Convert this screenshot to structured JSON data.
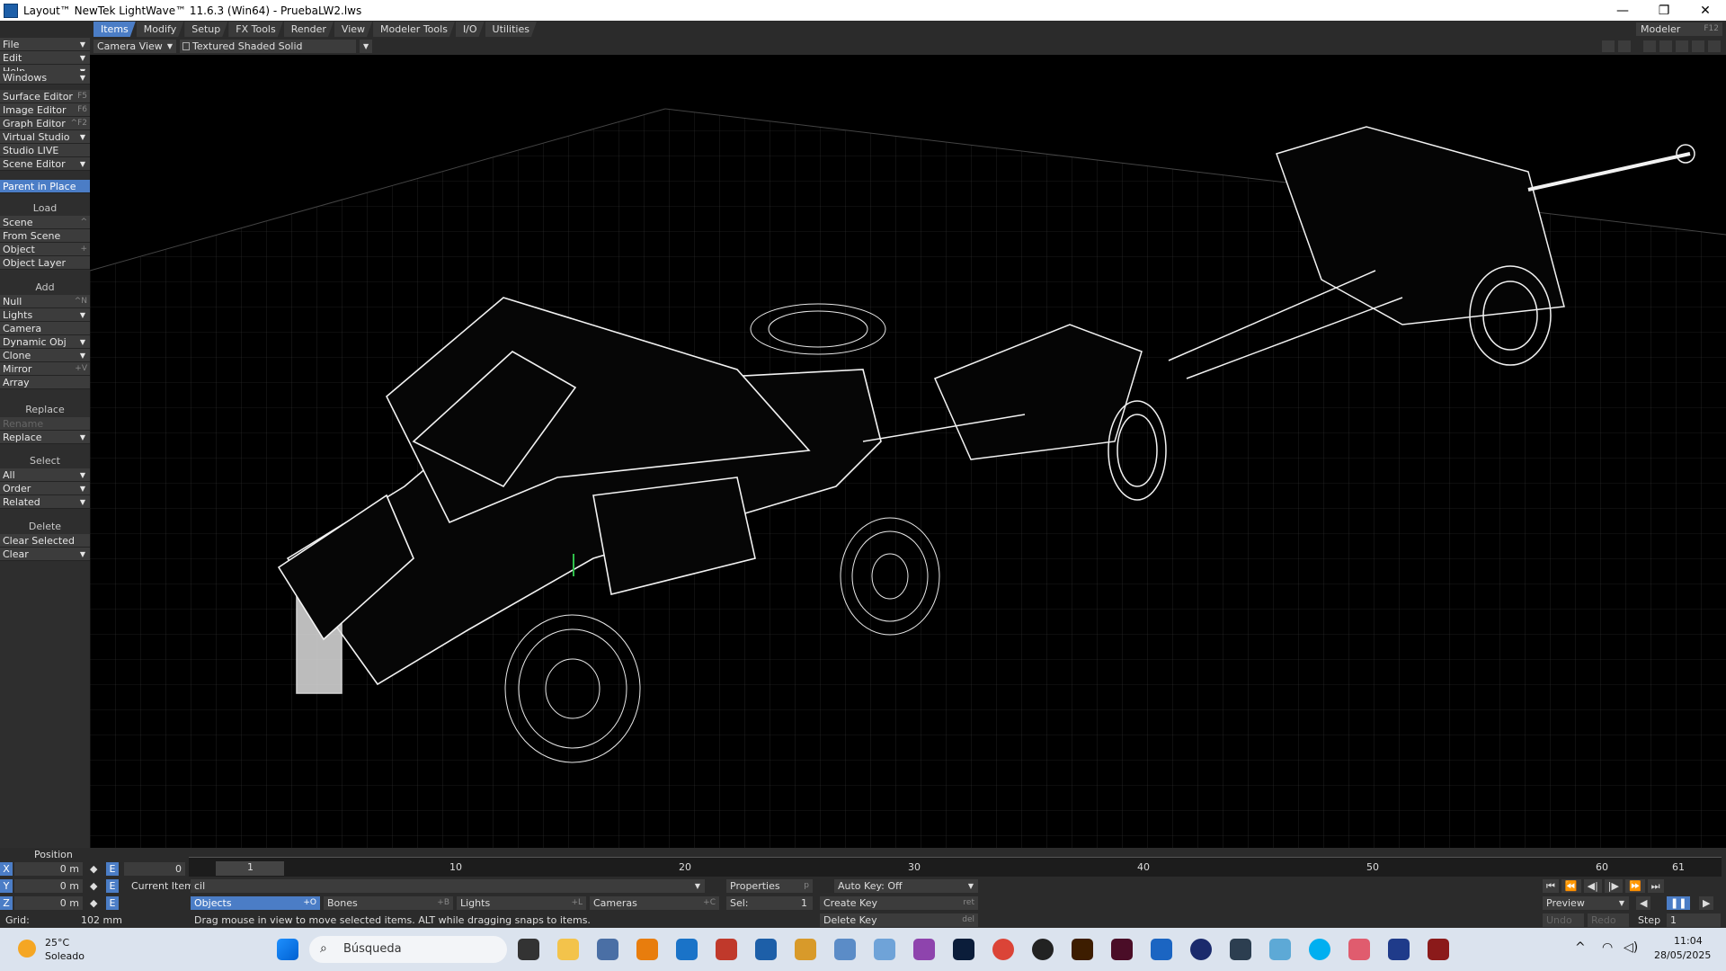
{
  "window": {
    "title": "Layout™ NewTek LightWave™ 11.6.3 (Win64) - PruebaLW2.lws",
    "minimize": "—",
    "maximize": "❐",
    "close": "✕"
  },
  "menu_tabs": [
    "Items",
    "Modify",
    "Setup",
    "FX Tools",
    "Render",
    "View",
    "Modeler Tools",
    "I/O",
    "Utilities"
  ],
  "modeler_button": {
    "label": "Modeler",
    "shortcut": "F12"
  },
  "left_panel": {
    "top": [
      {
        "label": "File",
        "dd": true
      },
      {
        "label": "Edit",
        "dd": true
      },
      {
        "label": "Help",
        "dd": true
      }
    ],
    "windows": {
      "label": "Windows",
      "dd": true
    },
    "editors": [
      {
        "label": "Surface Editor",
        "sc": "F5"
      },
      {
        "label": "Image Editor",
        "sc": "F6"
      },
      {
        "label": "Graph Editor",
        "sc": "^F2"
      },
      {
        "label": "Virtual Studio",
        "dd": true
      },
      {
        "label": "Studio LIVE"
      },
      {
        "label": "Scene Editor",
        "dd": true
      }
    ],
    "parent_in_place": "Parent in Place",
    "load_label": "Load",
    "load": [
      {
        "label": "Scene",
        "sc": "^"
      },
      {
        "label": "From Scene"
      },
      {
        "label": "Object",
        "sc": "+"
      },
      {
        "label": "Object Layer"
      }
    ],
    "add_label": "Add",
    "add": [
      {
        "label": "Null",
        "sc": "^N"
      },
      {
        "label": "Lights",
        "dd": true
      },
      {
        "label": "Camera"
      },
      {
        "label": "Dynamic Obj",
        "dd": true
      },
      {
        "label": "Clone",
        "dd": true
      },
      {
        "label": "Mirror",
        "sc": "+V"
      },
      {
        "label": "Array"
      }
    ],
    "replace_label": "Replace",
    "replace": [
      {
        "label": "Rename",
        "disabled": true
      },
      {
        "label": "Replace",
        "dd": true
      }
    ],
    "select_label": "Select",
    "select": [
      {
        "label": "All",
        "dd": true
      },
      {
        "label": "Order",
        "dd": true
      },
      {
        "label": "Related",
        "dd": true
      }
    ],
    "delete_label": "Delete",
    "delete": [
      {
        "label": "Clear Selected"
      },
      {
        "label": "Clear",
        "dd": true
      }
    ]
  },
  "viewport_bar": {
    "view": "Camera View",
    "shading": "Textured Shaded Solid Wireframe"
  },
  "bottom": {
    "position_label": "Position",
    "x_label": "X",
    "y_label": "Y",
    "z_label": "Z",
    "x_val": "0 m",
    "y_val": "0 m",
    "z_val": "0 m",
    "e_label": "E",
    "grid_label": "Grid:",
    "grid_val": "102 mm",
    "frame_start": "0",
    "ticks": [
      "1",
      "10",
      "20",
      "30",
      "40",
      "50",
      "60",
      "61"
    ],
    "current_item_label": "Current Item",
    "current_item": "cil",
    "properties": "Properties",
    "properties_sc": "p",
    "auto_key": "Auto Key: Off",
    "objects": "Objects",
    "objects_sc": "+O",
    "bones": "Bones",
    "bones_sc": "+B",
    "lights": "Lights",
    "lights_sc": "+L",
    "cameras": "Cameras",
    "cameras_sc": "+C",
    "sel_label": "Sel:",
    "sel_val": "1",
    "create_key": "Create Key",
    "create_key_sc": "ret",
    "delete_key": "Delete Key",
    "delete_key_sc": "del",
    "status": "Drag mouse in view to move selected items. ALT while dragging snaps to items.",
    "preview": "Preview",
    "undo": "Undo",
    "redo": "Redo",
    "step_label": "Step",
    "step_val": "1"
  },
  "taskbar": {
    "temp": "25°C",
    "weather": "Soleado",
    "search_placeholder": "Búsqueda",
    "time": "11:04",
    "date": "28/05/2025"
  }
}
